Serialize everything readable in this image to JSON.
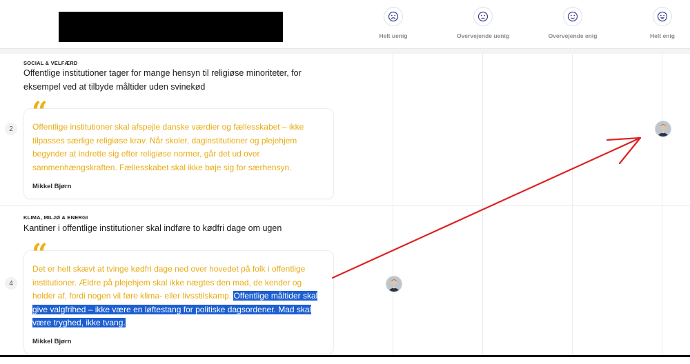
{
  "scale": [
    {
      "label": "Helt uenig",
      "icon": "very-sad-face-icon"
    },
    {
      "label": "Overvejende uenig",
      "icon": "sad-face-icon"
    },
    {
      "label": "Overvejende enig",
      "icon": "smile-face-icon"
    },
    {
      "label": "Helt enig",
      "icon": "big-smile-face-icon"
    }
  ],
  "statements": [
    {
      "number": "2",
      "category": "SOCIAL & VELFÆRD",
      "question": "Offentlige institutioner tager for mange hensyn til religiøse minoriteter, for eksempel ved at tilbyde måltider uden svinekød",
      "quote": "Offentlige institutioner skal afspejle danske værdier og fællesskabet – ikke tilpasses særlige religiøse krav. Når skoler, daginstitutioner og plejehjem begynder at indrette sig efter religiøse normer, går det ud over sammenhængskraften. Fællesskabet skal ikke bøje sig for særhensyn.",
      "author": "Mikkel Bjørn",
      "answer": "Helt enig"
    },
    {
      "number": "4",
      "category": "KLIMA, MILJØ & ENERGI",
      "question": "Kantiner i offentlige institutioner skal indføre to kødfri dage om ugen",
      "quote_plain": "Det er helt skævt at tvinge kødfri dage ned over hovedet på folk i offentlige institutioner.  Ældre på plejehjem skal ikke nægtes den mad, de kender og holder af, fordi nogen vil føre klima- eller livsstilskamp.",
      "quote_selected": "Offentlige måltider skal give valgfrihed – ikke være en løftestang for politiske dagsordener. Mad skal være tryghed, ikke tvang.",
      "author": "Mikkel Bjørn",
      "answer": "Helt uenig"
    }
  ],
  "colors": {
    "quote": "#e9ac12",
    "selection": "#1c5fd0",
    "annotation_arrow": "#e02020"
  }
}
